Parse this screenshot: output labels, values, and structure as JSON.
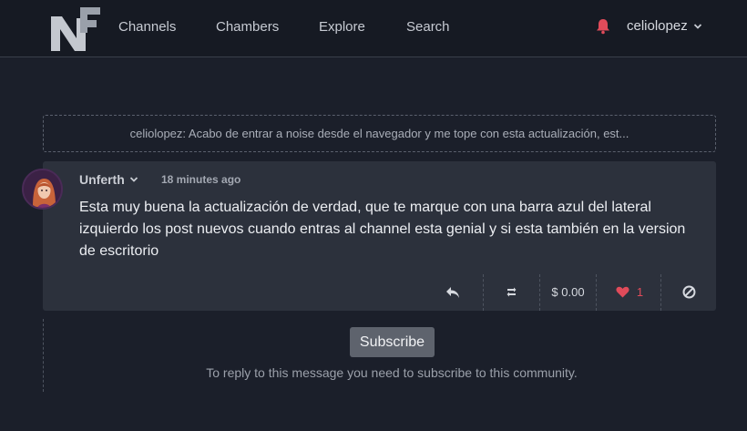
{
  "nav": {
    "items": [
      {
        "label": "Channels"
      },
      {
        "label": "Chambers"
      },
      {
        "label": "Explore"
      },
      {
        "label": "Search"
      }
    ],
    "username": "celiolopez"
  },
  "quote": {
    "text": "celiolopez: Acabo de entrar a noise desde el navegador y me tope con esta actualización, est..."
  },
  "comment": {
    "author": "Unferth",
    "time": "18 minutes ago",
    "body": "Esta muy buena la actualización de verdad, que te marque con una barra azul del lateral izquierdo los post nuevos cuando entras al channel esta genial y si esta también en la version de escritorio",
    "tip_amount": "$ 0.00",
    "likes": "1"
  },
  "subscribe": {
    "button_label": "Subscribe",
    "note": "To reply to this message you need to subscribe to this community."
  },
  "colors": {
    "accent_red": "#e04b5a",
    "background": "#1b1f2a",
    "card": "#2c313c"
  }
}
